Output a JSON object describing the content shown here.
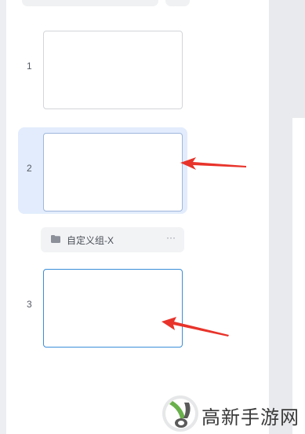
{
  "slides": [
    {
      "number": "1",
      "selected": false
    },
    {
      "number": "2",
      "selected": true
    },
    {
      "number": "3",
      "selected": false
    }
  ],
  "group": {
    "name": "自定义组-X",
    "icon": "folder-icon",
    "more_icon": "more-icon",
    "more_label": "···"
  },
  "annotations": {
    "arrow_color": "#e8332a"
  },
  "watermark": {
    "text": "高新手游网",
    "logo": "watermark-logo"
  },
  "colors": {
    "selected_bg": "#e2ecfc",
    "highlight_border": "#3b8ed9"
  }
}
